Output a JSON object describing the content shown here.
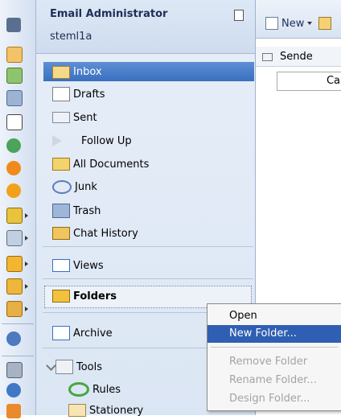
{
  "navigator": {
    "title": "Email Administrator",
    "user": "steml1a",
    "mail_folders": [
      {
        "label": "Inbox",
        "icon": "inbox-icon"
      },
      {
        "label": "Drafts",
        "icon": "drafts-icon"
      },
      {
        "label": "Sent",
        "icon": "sent-icon"
      },
      {
        "label": "Follow Up",
        "icon": "flag-icon"
      },
      {
        "label": "All Documents",
        "icon": "all-documents-icon"
      },
      {
        "label": "Junk",
        "icon": "junk-icon"
      },
      {
        "label": "Trash",
        "icon": "trash-icon"
      },
      {
        "label": "Chat History",
        "icon": "chat-history-icon"
      }
    ],
    "views_label": "Views",
    "folders_label": "Folders",
    "archive_label": "Archive",
    "tools_label": "Tools",
    "rules_label": "Rules",
    "stationery_label": "Stationery"
  },
  "toolbar": {
    "new_label": "New"
  },
  "list": {
    "sender_header": "Sende",
    "cell_text": "Ca"
  },
  "context_menu": {
    "items": [
      {
        "label": "Open",
        "state": "normal"
      },
      {
        "label": "New Folder...",
        "state": "highlighted"
      },
      {
        "label": "Remove Folder",
        "state": "disabled"
      },
      {
        "label": "Rename Folder...",
        "state": "disabled"
      },
      {
        "label": "Design Folder...",
        "state": "disabled"
      }
    ]
  },
  "colors": {
    "selection": "#3a6fbf",
    "menu_highlight": "#2f5fb3",
    "nav_background": "#dbe6f4"
  }
}
